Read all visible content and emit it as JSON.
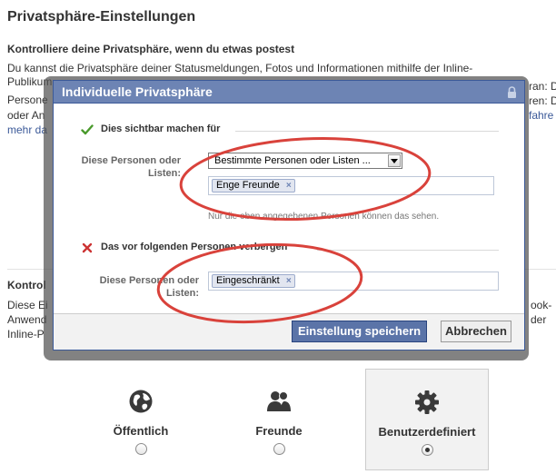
{
  "page": {
    "title": "Privatsphäre-Einstellungen",
    "section1": {
      "heading": "Kontrolliere deine Privatsphäre, wenn du etwas postest",
      "lines": [
        "Du kannst die Privatsphäre deiner Statusmeldungen, Fotos und Informationen mithilfe der Inline-",
        "Publikum",
        "Persone",
        "oder An",
        "mehr da"
      ],
      "right_fragments": [
        "ran: D",
        "ren: D",
        "fahre"
      ]
    },
    "section2": {
      "heading": "Kontrol",
      "lines": [
        "Diese Ei",
        "Anwend",
        "Inline-P"
      ],
      "right_fragments": [
        "ook-",
        "der"
      ]
    }
  },
  "dialog": {
    "title": "Individuelle Privatsphäre",
    "show_section": {
      "heading": "Dies sichtbar machen für",
      "field_label": "Diese Personen oder Listen:",
      "select_value": "Bestimmte Personen oder Listen ...",
      "token": "Enge Freunde",
      "hint": "Nur die oben angegebenen Personen können das sehen."
    },
    "hide_section": {
      "heading": "Das vor folgenden Personen verbergen",
      "field_label": "Diese Personen oder Listen:",
      "token": "Eingeschränkt"
    },
    "save_label": "Einstellung speichern",
    "cancel_label": "Abbrechen"
  },
  "options": [
    {
      "label": "Öffentlich",
      "icon": "globe-icon",
      "selected": false
    },
    {
      "label": "Freunde",
      "icon": "friends-icon",
      "selected": false
    },
    {
      "label": "Benutzerdefiniert",
      "icon": "gear-icon",
      "selected": true
    }
  ],
  "colors": {
    "header_blue": "#6d84b4",
    "primary_button": "#5b74a8",
    "link_blue": "#3b5998",
    "annotation_red": "#d9423b",
    "check_green": "#4a9a2c",
    "cross_red": "#cc3333"
  }
}
